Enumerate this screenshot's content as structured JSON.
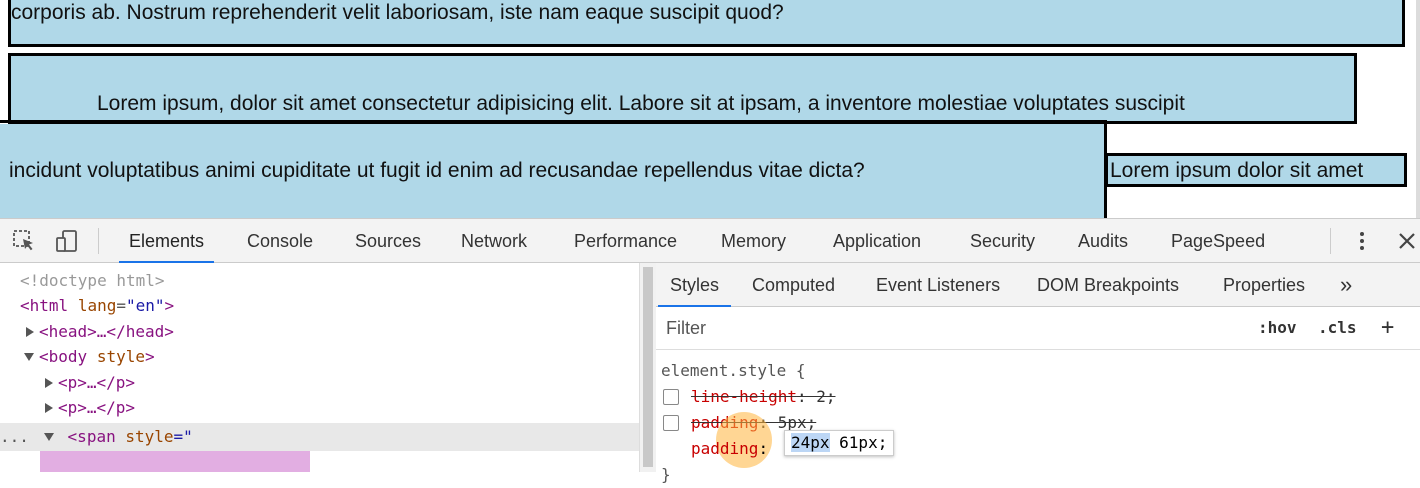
{
  "page": {
    "para1_text": "corporis ab. Nostrum reprehenderit velit laboriosam, iste nam eaque suscipit quod?",
    "para2_line1": "Lorem ipsum, dolor sit amet consectetur adipisicing elit. Labore sit at ipsam, a inventore molestiae voluptates suscipit",
    "para2_line2": "incidunt voluptatibus animi cupiditate ut fugit id enim ad recusandae repellendus vitae dicta?",
    "span_text": "Lorem ipsum dolor sit amet",
    "colors": {
      "box_bg": "#b0d8e8",
      "border": "#000000"
    }
  },
  "devtools": {
    "tabs": [
      "Elements",
      "Console",
      "Sources",
      "Network",
      "Performance",
      "Memory",
      "Application",
      "Security",
      "Audits",
      "PageSpeed"
    ],
    "active_tab": "Elements",
    "icons": {
      "inspect": "inspect-element-icon",
      "device": "device-toolbar-icon",
      "menu": "more-vertical-icon",
      "close": "close-icon"
    },
    "dom": {
      "doctype": "<!doctype html>",
      "html_open": "<html",
      "html_attr": "lang",
      "html_attr_val": "\"en\"",
      "html_close": ">",
      "head": "<head>…</head>",
      "body_open": "<body",
      "body_attr": "style",
      "body_close": ">",
      "p1": "<p>…</p>",
      "p2": "<p>…</p>",
      "span_open": "<span",
      "span_attr": "style",
      "span_attr_val": "=\"",
      "ellipsis": "..."
    },
    "styles": {
      "sub_tabs": [
        "Styles",
        "Computed",
        "Event Listeners",
        "DOM Breakpoints",
        "Properties"
      ],
      "more": "»",
      "filter_placeholder": "Filter",
      "hov": ":hov",
      "cls": ".cls",
      "add": "+",
      "selector": "element.style {",
      "decl1_prop": "line-height",
      "decl1_val": ": 2;",
      "decl2_prop": "padding",
      "decl2_val": ": 5px;",
      "decl3_prop": "padding",
      "decl3_colon": ": ",
      "decl3_sel": "24px",
      "decl3_rest": " 61px;",
      "close_brace": "}"
    }
  }
}
